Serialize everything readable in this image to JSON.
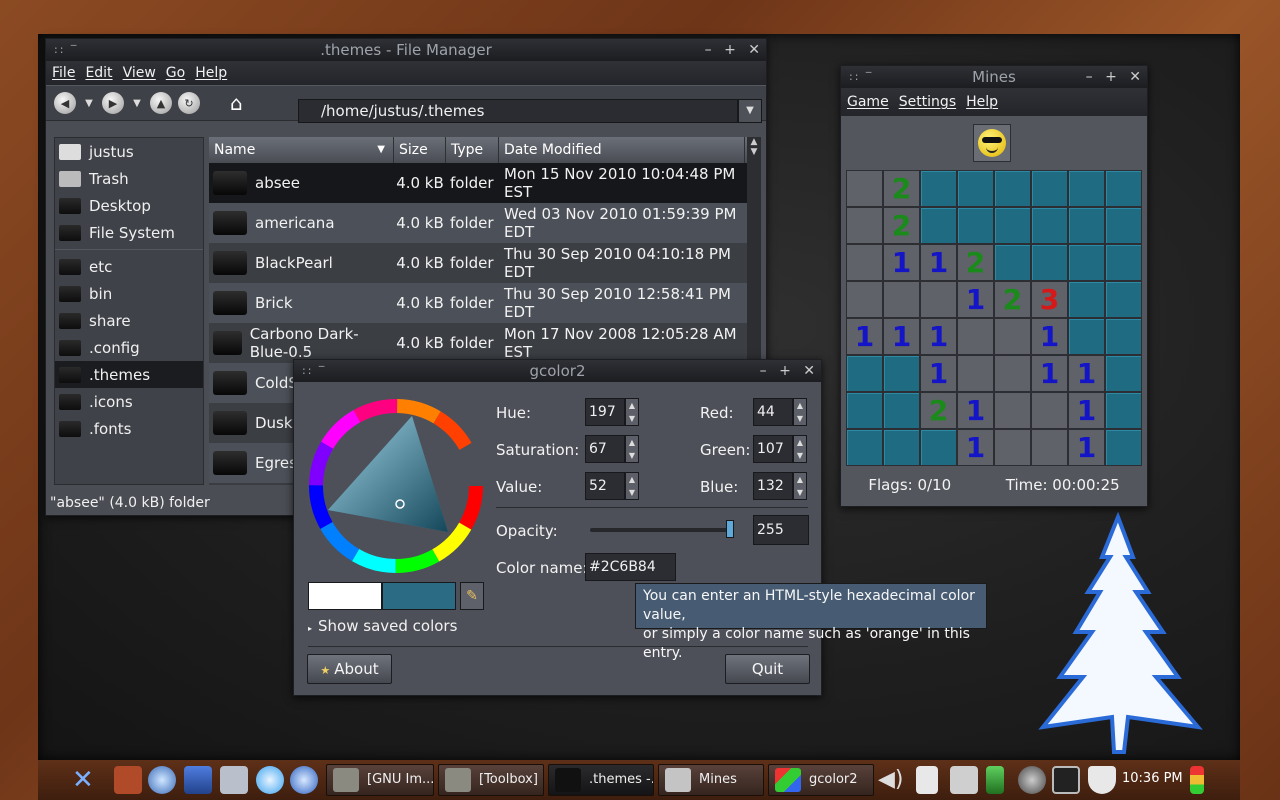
{
  "file_manager": {
    "title": ".themes - File Manager",
    "menus": [
      "File",
      "Edit",
      "View",
      "Go",
      "Help"
    ],
    "path": "/home/justus/.themes",
    "places": [
      "justus",
      "Trash",
      "Desktop",
      "File System"
    ],
    "bookmarks": [
      "etc",
      "bin",
      "share",
      ".config",
      ".themes",
      ".icons",
      ".fonts"
    ],
    "selected_bookmark": ".themes",
    "columns": [
      "Name",
      "Size",
      "Type",
      "Date Modified"
    ],
    "rows": [
      {
        "name": "absee",
        "size": "4.0 kB",
        "type": "folder",
        "date": "Mon 15 Nov 2010 10:04:48 PM EST"
      },
      {
        "name": "americana",
        "size": "4.0 kB",
        "type": "folder",
        "date": "Wed 03 Nov 2010 01:59:39 PM EDT"
      },
      {
        "name": "BlackPearl",
        "size": "4.0 kB",
        "type": "folder",
        "date": "Thu 30 Sep 2010 04:10:18 PM EDT"
      },
      {
        "name": "Brick",
        "size": "4.0 kB",
        "type": "folder",
        "date": "Thu 30 Sep 2010 12:58:41 PM EDT"
      },
      {
        "name": "Carbono Dark-Blue-0.5",
        "size": "4.0 kB",
        "type": "folder",
        "date": "Mon 17 Nov 2008 12:05:28 AM EST"
      },
      {
        "name": "ColdS",
        "size": "",
        "type": "",
        "date": ""
      },
      {
        "name": "Dusk",
        "size": "",
        "type": "",
        "date": ""
      },
      {
        "name": "Egress",
        "size": "",
        "type": "",
        "date": ""
      }
    ],
    "status": "\"absee\" (4.0 kB) folder"
  },
  "mines": {
    "title": "Mines",
    "menus": [
      "Game",
      "Settings",
      "Help"
    ],
    "board": [
      [
        "o",
        "2",
        "c",
        "c",
        "c",
        "c",
        "c",
        "c"
      ],
      [
        "o",
        "2",
        "c",
        "c",
        "c",
        "c",
        "c",
        "c"
      ],
      [
        "o",
        "1",
        "1",
        "2",
        "c",
        "c",
        "c",
        "c"
      ],
      [
        "o",
        "o",
        "o",
        "1",
        "2",
        "3",
        "c",
        "c"
      ],
      [
        "1",
        "1",
        "1",
        "o",
        "o",
        "1",
        "c",
        "c"
      ],
      [
        "c",
        "c",
        "1",
        "o",
        "o",
        "1",
        "1",
        "c"
      ],
      [
        "c",
        "c",
        "2",
        "1",
        "o",
        "o",
        "1",
        "c"
      ],
      [
        "c",
        "c",
        "c",
        "1",
        "o",
        "o",
        "1",
        "c"
      ]
    ],
    "flags": "Flags: 0/10",
    "time": "Time: 00:00:25"
  },
  "gcolor2": {
    "title": "gcolor2",
    "hue_label": "Hue:",
    "hue": "197",
    "saturation_label": "Saturation:",
    "saturation": "67",
    "value_label": "Value:",
    "value": "52",
    "red_label": "Red:",
    "red": "44",
    "green_label": "Green:",
    "green": "107",
    "blue_label": "Blue:",
    "blue": "132",
    "opacity_label": "Opacity:",
    "opacity": "255",
    "color_name_label": "Color name:",
    "color_name": "#2C6B84",
    "show_saved": "Show saved colors",
    "about": "About",
    "quit": "Quit",
    "current_color": "#2C6B84",
    "tooltip_line1": "You can enter an HTML-style hexadecimal color value,",
    "tooltip_line2": "or simply a color name such as 'orange' in this entry."
  },
  "taskbar": {
    "tasks": [
      "[GNU Im...",
      "[Toolbox]",
      ".themes -...",
      "Mines",
      "gcolor2"
    ],
    "clock": "10:36 PM"
  }
}
